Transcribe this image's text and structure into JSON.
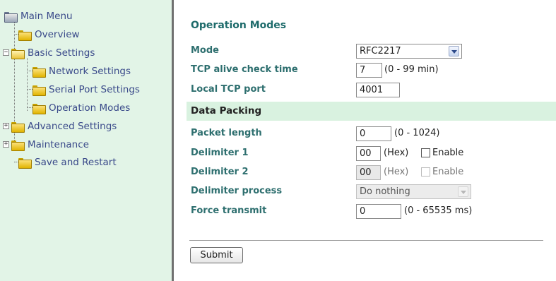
{
  "sidebar": {
    "items": [
      {
        "label": "Main Menu",
        "icon": "folder-open-root-icon"
      },
      {
        "label": "Overview",
        "icon": "folder-icon"
      },
      {
        "label": "Basic Settings",
        "icon": "folder-open-icon"
      },
      {
        "label": "Network Settings",
        "icon": "folder-icon"
      },
      {
        "label": "Serial Port Settings",
        "icon": "folder-icon"
      },
      {
        "label": "Operation Modes",
        "icon": "folder-icon"
      },
      {
        "label": "Advanced Settings",
        "icon": "folder-icon"
      },
      {
        "label": "Maintenance",
        "icon": "folder-icon"
      },
      {
        "label": "Save and Restart",
        "icon": "folder-icon"
      }
    ]
  },
  "main": {
    "title": "Operation Modes",
    "mode": {
      "label": "Mode",
      "value": "RFC2217"
    },
    "tcp_alive": {
      "label": "TCP alive check time",
      "value": "7",
      "hint": "(0 - 99 min)"
    },
    "local_tcp_port": {
      "label": "Local TCP port",
      "value": "4001"
    },
    "data_packing": {
      "heading": "Data Packing"
    },
    "packet_length": {
      "label": "Packet length",
      "value": "0",
      "hint": "(0 - 1024)"
    },
    "delimiter1": {
      "label": "Delimiter 1",
      "value": "00",
      "hint": "(Hex)",
      "checkbox_label": "Enable",
      "checked": false
    },
    "delimiter2": {
      "label": "Delimiter 2",
      "value": "00",
      "hint": "(Hex)",
      "checkbox_label": "Enable",
      "checked": false
    },
    "delimiter_process": {
      "label": "Delimiter process",
      "value": "Do nothing"
    },
    "force_transmit": {
      "label": "Force transmit",
      "value": "0",
      "hint": "(0 - 65535 ms)"
    },
    "submit_label": "Submit"
  },
  "colors": {
    "sidebar_bg": "#e2f4e7",
    "section_bar_bg": "#d9f2e0",
    "label_text": "#2e6f6f",
    "title_text": "#1e6b6b",
    "tree_text": "#3a4a8a"
  }
}
